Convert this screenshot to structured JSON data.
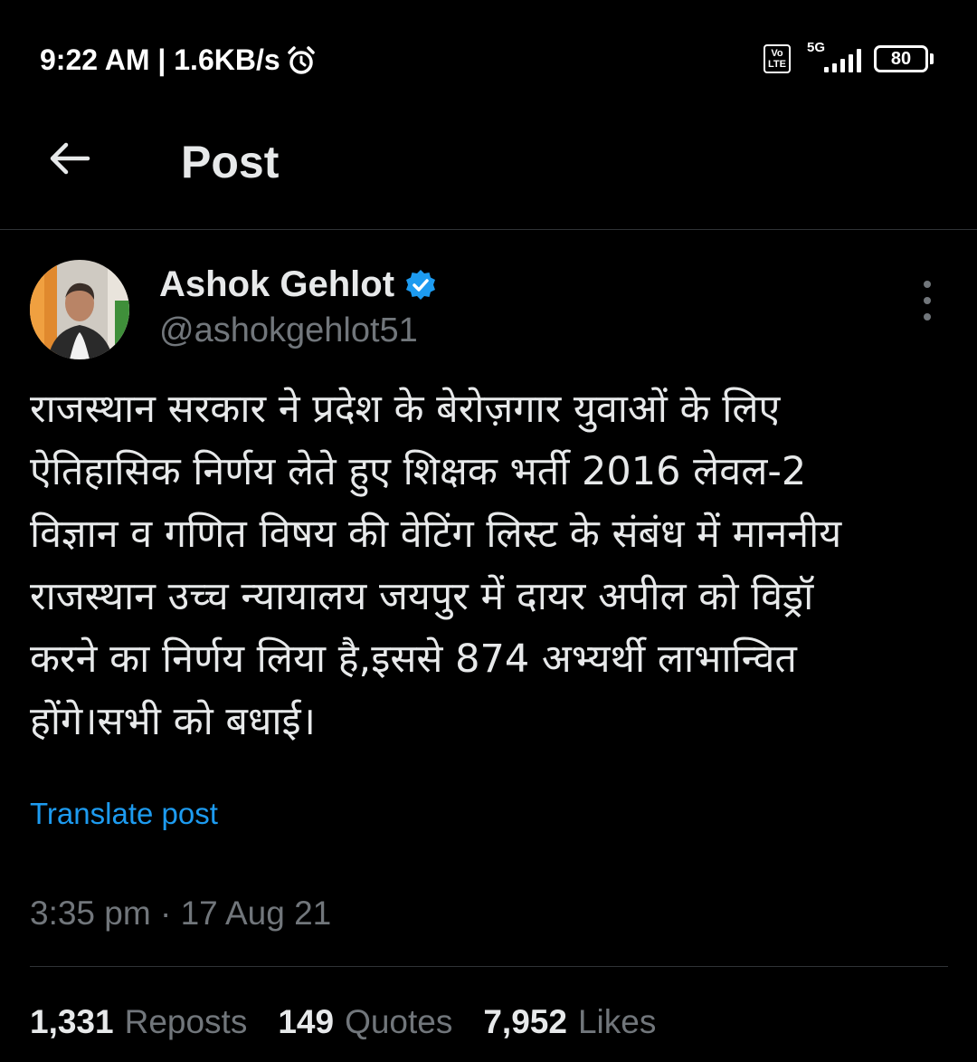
{
  "status_bar": {
    "time_speed": "9:22 AM | 1.6KB/s",
    "volte_top": "Vo",
    "volte_bottom": "LTE",
    "network": "5G",
    "battery": "80"
  },
  "header": {
    "title": "Post"
  },
  "post": {
    "author_name": "Ashok Gehlot",
    "author_handle": "@ashokgehlot51",
    "text": "राजस्थान सरकार ने प्रदेश के बेरोज़गार युवाओं के लिए\nऐतिहासिक निर्णय लेते हुए शिक्षक भर्ती 2016 लेवल-2\nविज्ञान व गणित विषय की वेटिंग लिस्ट के संबंध में माननीय\nराजस्थान उच्च न्यायालय जयपुर में दायर अपील को विड्रॉ\nकरने का निर्णय लिया है,इससे 874 अभ्यर्थी लाभान्वित\nहोंगे।सभी को बधाई।",
    "translate_label": "Translate post",
    "timestamp": "3:35 pm · 17 Aug 21"
  },
  "stats": {
    "reposts_count": "1,331",
    "reposts_label": "Reposts",
    "quotes_count": "149",
    "quotes_label": "Quotes",
    "likes_count": "7,952",
    "likes_label": "Likes"
  },
  "colors": {
    "background": "#000000",
    "primary_text": "#e7e9ea",
    "secondary_text": "#71767b",
    "link": "#1d9bf0",
    "verified": "#1d9bf0"
  }
}
